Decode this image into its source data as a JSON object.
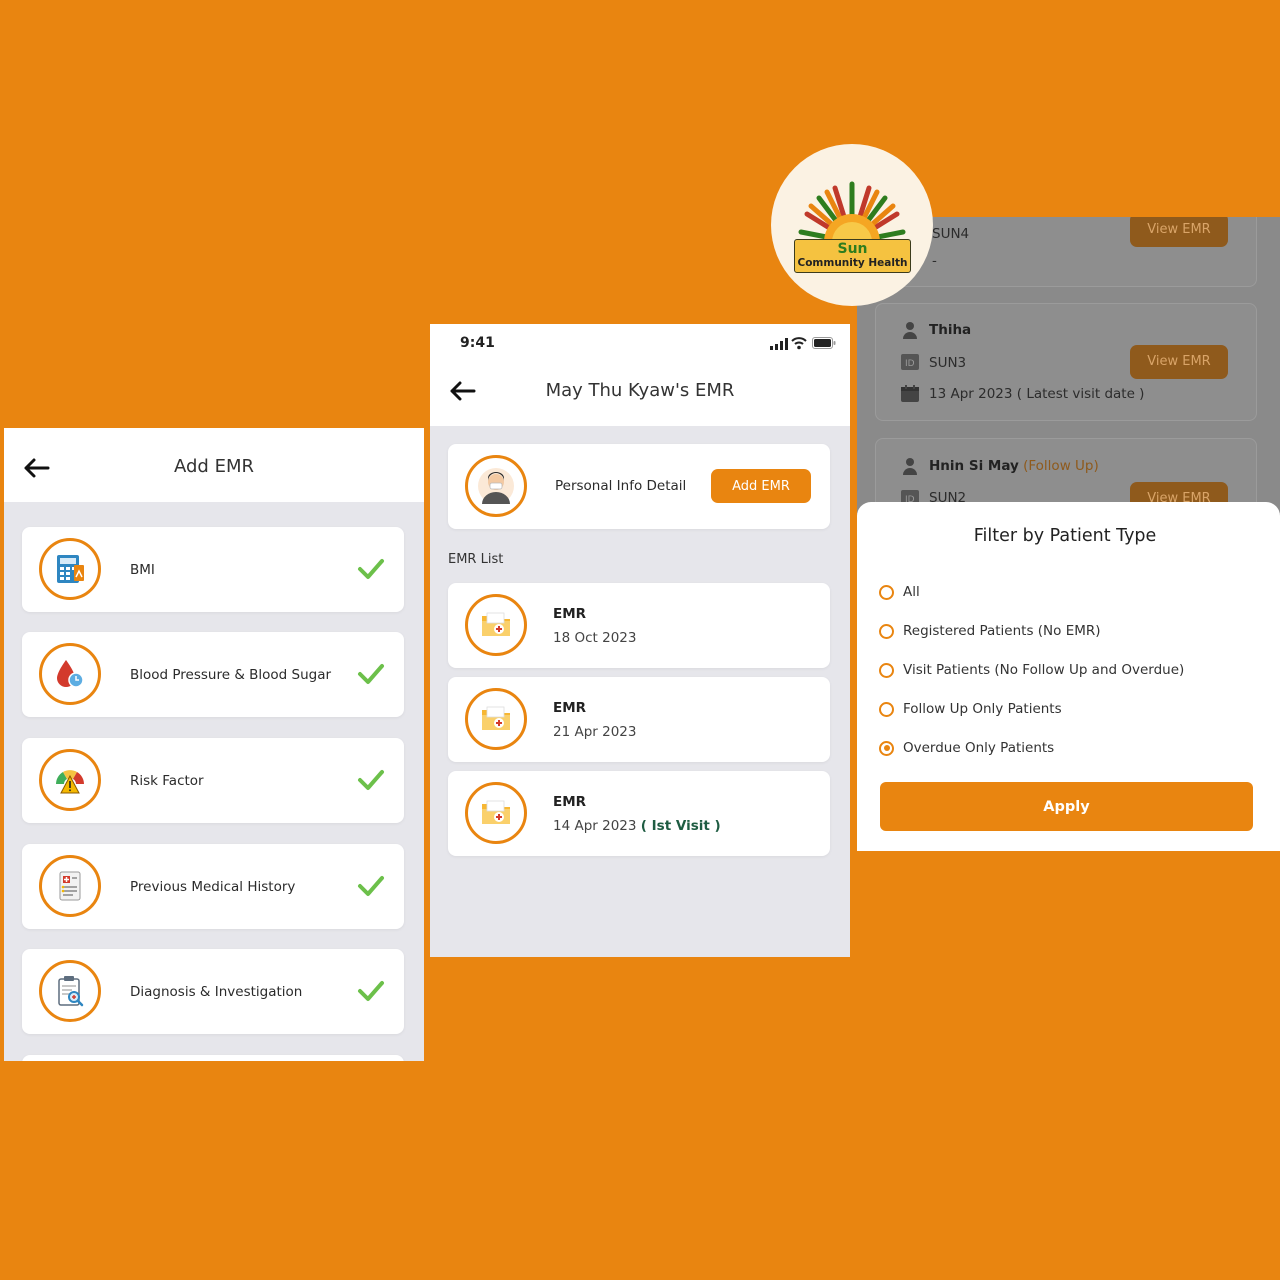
{
  "colors": {
    "accent": "#E98510",
    "check": "#6CC04A",
    "first_visit": "#1E5C42"
  },
  "add_emr_screen": {
    "title": "Add EMR",
    "items": [
      {
        "label": "BMI",
        "icon": "bmi-calculator-icon",
        "completed": true
      },
      {
        "label": "Blood Pressure & Blood Sugar",
        "icon": "blood-drop-icon",
        "completed": true
      },
      {
        "label": "Risk Factor",
        "icon": "risk-gauge-icon",
        "completed": true
      },
      {
        "label": "Previous Medical History",
        "icon": "medical-record-icon",
        "completed": true
      },
      {
        "label": "Diagnosis & Investigation",
        "icon": "clipboard-search-icon",
        "completed": true
      }
    ]
  },
  "emr_screen": {
    "status_time": "9:41",
    "title": "May Thu Kyaw's EMR",
    "personal_info_label": "Personal Info Detail",
    "add_emr_label": "Add EMR",
    "emr_list_label": "EMR List",
    "records": [
      {
        "title": "EMR",
        "date": "18 Oct 2023",
        "note": ""
      },
      {
        "title": "EMR",
        "date": "21 Apr 2023",
        "note": ""
      },
      {
        "title": "EMR",
        "date": "14 Apr 2023",
        "note": "( Ist Visit )"
      }
    ]
  },
  "filter_screen": {
    "background_cards": {
      "card1": {
        "id": "SUN4",
        "button": "View EMR",
        "extra": "-"
      },
      "card2": {
        "name": "Thiha",
        "id": "SUN3",
        "date": "13 Apr 2023 ( Latest visit date )",
        "button": "View EMR"
      },
      "card3": {
        "name": "Hnin Si May",
        "tag": "(Follow Up)",
        "id": "SUN2",
        "button": "View EMR"
      }
    },
    "sheet_title": "Filter by Patient Type",
    "options": [
      {
        "label": "All",
        "selected": false
      },
      {
        "label": "Registered Patients (No EMR)",
        "selected": false
      },
      {
        "label": "Visit Patients (No Follow Up and Overdue)",
        "selected": false
      },
      {
        "label": "Follow Up Only Patients",
        "selected": false
      },
      {
        "label": "Overdue Only Patients",
        "selected": true
      }
    ],
    "apply_label": "Apply"
  },
  "logo": {
    "line1": "Sun",
    "line2": "Community Health"
  }
}
